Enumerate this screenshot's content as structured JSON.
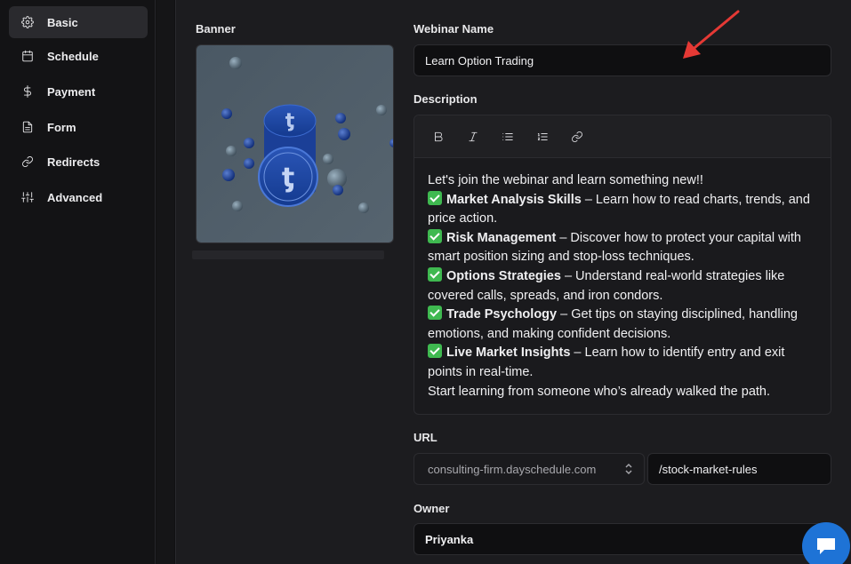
{
  "sidebar": {
    "items": [
      {
        "label": "Basic",
        "icon": "gear-icon",
        "active": true
      },
      {
        "label": "Schedule",
        "icon": "calendar-icon"
      },
      {
        "label": "Payment",
        "icon": "dollar-icon"
      },
      {
        "label": "Form",
        "icon": "document-icon"
      },
      {
        "label": "Redirects",
        "icon": "link-icon"
      },
      {
        "label": "Advanced",
        "icon": "sliders-icon"
      }
    ]
  },
  "banner": {
    "label": "Banner",
    "image": "coins-illustration"
  },
  "webinar_name": {
    "label": "Webinar Name",
    "value": "Learn Option Trading"
  },
  "description": {
    "label": "Description",
    "toolbar": [
      "bold-icon",
      "italic-icon",
      "bullet-list-icon",
      "numbered-list-icon",
      "link-icon"
    ],
    "intro": "Let's join the webinar and learn something new!!",
    "points": [
      {
        "title": "Market Analysis Skills",
        "text": " – Learn how to read charts, trends, and price action."
      },
      {
        "title": "Risk Management",
        "text": " – Discover how to protect your capital with smart position sizing and stop-loss techniques."
      },
      {
        "title": "Options Strategies",
        "text": " – Understand real-world strategies like covered calls, spreads, and iron condors."
      },
      {
        "title": "Trade Psychology",
        "text": " – Get tips on staying disciplined, handling emotions, and making confident decisions."
      },
      {
        "title": "Live Market Insights",
        "text": " – Learn how to identify entry and exit points in real-time."
      }
    ],
    "outro": "Start learning from someone who’s already walked the path."
  },
  "url": {
    "label": "URL",
    "domain": "consulting-firm.dayschedule.com",
    "slug": "/stock-market-rules"
  },
  "owner": {
    "label": "Owner",
    "value": "Priyanka"
  },
  "colors": {
    "accent": "#1e73d6",
    "arrow": "#e53935",
    "check": "#3fb950"
  }
}
